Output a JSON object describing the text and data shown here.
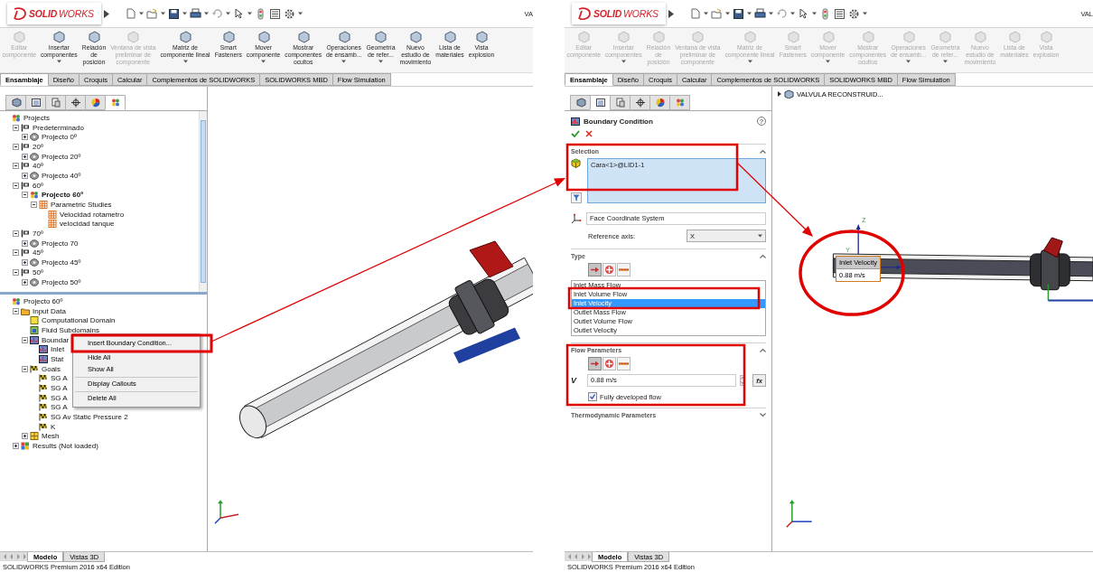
{
  "left_window": {
    "app_name": "**SOLID**WORKS",
    "title_fragment": "VA",
    "ribbon": [
      {
        "label": "Editar\ncomponente",
        "disabled": true,
        "dropdown": false
      },
      {
        "label": "Insertar\ncomponentes",
        "disabled": false,
        "dropdown": true
      },
      {
        "label": "Relación\nde\nposición",
        "disabled": false,
        "dropdown": false
      },
      {
        "label": "Ventana de vista\npreliminar de\ncomponente",
        "disabled": true,
        "dropdown": false
      },
      {
        "label": "Matriz de\ncomponente lineal",
        "disabled": false,
        "dropdown": true
      },
      {
        "label": "Smart\nFasteners",
        "disabled": false,
        "dropdown": false
      },
      {
        "label": "Mover\ncomponente",
        "disabled": false,
        "dropdown": true
      },
      {
        "label": "Mostrar\ncomponentes\nocultos",
        "disabled": false,
        "dropdown": false
      },
      {
        "label": "Operaciones\nde ensamb...",
        "disabled": false,
        "dropdown": true
      },
      {
        "label": "Geometría\nde refer...",
        "disabled": false,
        "dropdown": true
      },
      {
        "label": "Nuevo\nestudio de\nmovimiento",
        "disabled": false,
        "dropdown": false
      },
      {
        "label": "Lista de\nmateriales",
        "disabled": false,
        "dropdown": false
      },
      {
        "label": "Vista\nexplosion",
        "disabled": false,
        "dropdown": false
      }
    ],
    "command_tabs": [
      {
        "label": "Ensamblaje",
        "selected": true
      },
      {
        "label": "Diseño",
        "selected": false
      },
      {
        "label": "Croquis",
        "selected": false
      },
      {
        "label": "Calcular",
        "selected": false
      },
      {
        "label": "Complementos de SOLIDWORKS",
        "selected": false
      },
      {
        "label": "SOLIDWORKS MBD",
        "selected": false
      },
      {
        "label": "Flow Simulation",
        "selected": false
      }
    ],
    "panel_tabs": [
      {
        "kind": "feature_tree",
        "selected": false
      },
      {
        "kind": "property",
        "selected": false
      },
      {
        "kind": "configuration",
        "selected": false
      },
      {
        "kind": "dimxpert",
        "selected": false
      },
      {
        "kind": "display",
        "selected": false
      },
      {
        "kind": "flow",
        "selected": true
      }
    ],
    "project_tree": [
      {
        "label": "Projects",
        "kind": "projects",
        "children": [
          {
            "label": "Predeterminado",
            "kind": "config",
            "expanded": true,
            "children": [
              {
                "label": "Projecto 0º",
                "kind": "study",
                "expanded": false
              }
            ]
          },
          {
            "label": "20º",
            "kind": "config",
            "expanded": true,
            "children": [
              {
                "label": "Projecto 20º",
                "kind": "study",
                "expanded": false
              }
            ]
          },
          {
            "label": "40º",
            "kind": "config",
            "expanded": true,
            "children": [
              {
                "label": "Projecto 40º",
                "kind": "study",
                "expanded": false
              }
            ]
          },
          {
            "label": "60º",
            "kind": "config",
            "expanded": true,
            "children": [
              {
                "label": "Projecto 60º",
                "kind": "project",
                "expanded": true,
                "active": true,
                "children": [
                  {
                    "label": "Parametric Studies",
                    "kind": "table",
                    "expanded": true,
                    "children": [
                      {
                        "label": "Velocidad rotametro",
                        "kind": "table"
                      },
                      {
                        "label": "velocidad tanque",
                        "kind": "table"
                      }
                    ]
                  }
                ]
              }
            ]
          },
          {
            "label": "70º",
            "kind": "config",
            "expanded": true,
            "children": [
              {
                "label": "Projecto 70",
                "kind": "study",
                "expanded": false
              }
            ]
          },
          {
            "label": "45º",
            "kind": "config",
            "expanded": true,
            "children": [
              {
                "label": "Projecto 45º",
                "kind": "study",
                "expanded": false
              }
            ]
          },
          {
            "label": "50º",
            "kind": "config",
            "expanded": true,
            "children": [
              {
                "label": "Projecto 50º",
                "kind": "study",
                "expanded": false
              }
            ]
          }
        ]
      }
    ],
    "analysis_tree": [
      {
        "label": "Projecto 60º",
        "kind": "project",
        "children": [
          {
            "label": "Input Data",
            "kind": "folder",
            "expanded": true,
            "children": [
              {
                "label": "Computational Domain",
                "kind": "domain"
              },
              {
                "label": "Fluid Subdomains",
                "kind": "subdomain"
              },
              {
                "label": "Boundar",
                "kind": "boundary",
                "expanded": true,
                "children": [
                  {
                    "label": "Inlet",
                    "kind": "boundary"
                  },
                  {
                    "label": "Stat",
                    "kind": "boundary"
                  }
                ]
              },
              {
                "label": "Goals",
                "kind": "goals",
                "expanded": true,
                "children": [
                  {
                    "label": "SG A",
                    "kind": "goal"
                  },
                  {
                    "label": "SG A",
                    "kind": "goal"
                  },
                  {
                    "label": "SG A",
                    "kind": "goal"
                  },
                  {
                    "label": "SG A",
                    "kind": "goal"
                  },
                  {
                    "label": "SG Av Static Pressure 2",
                    "kind": "goal"
                  },
                  {
                    "label": "K",
                    "kind": "goal"
                  }
                ]
              },
              {
                "label": "Mesh",
                "kind": "mesh",
                "expanded": false
              }
            ]
          },
          {
            "label": "Results (Not loaded)",
            "kind": "results",
            "expanded": false
          }
        ]
      }
    ],
    "context_menu": [
      {
        "label": "Insert Boundary Condition...",
        "separator_before": false
      },
      {
        "label": "Hide All",
        "separator_before": true
      },
      {
        "label": "Show All",
        "separator_before": false
      },
      {
        "label": "Display Callouts",
        "separator_before": true
      },
      {
        "label": "Delete All",
        "separator_before": true
      }
    ],
    "viewport": {
      "kind": "diagonal_view"
    },
    "model_tabs": [
      {
        "label": "Modelo",
        "selected": true
      },
      {
        "label": "Vistas 3D",
        "selected": false
      }
    ],
    "status": "SOLIDWORKS Premium 2016 x64 Edition"
  },
  "right_window": {
    "app_name": "**SOLID**WORKS",
    "title_fragment": "VAL",
    "ribbon": [
      {
        "label": "Editar\ncomponente",
        "disabled": true,
        "dropdown": false
      },
      {
        "label": "Insertar\ncomponentes",
        "disabled": true,
        "dropdown": true
      },
      {
        "label": "Relación\nde\nposición",
        "disabled": true,
        "dropdown": false
      },
      {
        "label": "Ventana de vista\npreliminar de\ncomponente",
        "disabled": true,
        "dropdown": false
      },
      {
        "label": "Matriz de\ncomponente lineal",
        "disabled": true,
        "dropdown": true
      },
      {
        "label": "Smart\nFasteners",
        "disabled": true,
        "dropdown": false
      },
      {
        "label": "Mover\ncomponente",
        "disabled": true,
        "dropdown": true
      },
      {
        "label": "Mostrar\ncomponentes\nocultos",
        "disabled": true,
        "dropdown": false
      },
      {
        "label": "Operaciones\nde ensamb...",
        "disabled": true,
        "dropdown": true
      },
      {
        "label": "Geometría\nde refer...",
        "disabled": true,
        "dropdown": true
      },
      {
        "label": "Nuevo\nestudio de\nmovimiento",
        "disabled": true,
        "dropdown": false
      },
      {
        "label": "Lista de\nmateriales",
        "disabled": true,
        "dropdown": false
      },
      {
        "label": "Vista\nexplosion",
        "disabled": true,
        "dropdown": false
      }
    ],
    "command_tabs": [
      {
        "label": "Ensamblaje",
        "selected": true
      },
      {
        "label": "Diseño",
        "selected": false
      },
      {
        "label": "Croquis",
        "selected": false
      },
      {
        "label": "Calcular",
        "selected": false
      },
      {
        "label": "Complementos de SOLIDWORKS",
        "selected": false
      },
      {
        "label": "SOLIDWORKS MBD",
        "selected": false
      },
      {
        "label": "Flow Simulation",
        "selected": false
      }
    ],
    "panel_tabs": [
      {
        "kind": "feature_tree",
        "selected": false
      },
      {
        "kind": "property",
        "selected": true
      },
      {
        "kind": "configuration",
        "selected": false
      },
      {
        "kind": "dimxpert",
        "selected": false
      },
      {
        "kind": "display",
        "selected": false
      },
      {
        "kind": "flow",
        "selected": false
      }
    ],
    "property_manager": {
      "title": "Boundary Condition",
      "help": "?",
      "sections": [
        {
          "kind": "selection",
          "title": "Selection",
          "expanded": true,
          "items": [
            "Cara<1>@LID1-1"
          ],
          "coordinate_system": "Face Coordinate System",
          "reference_axis_label": "Reference axis:",
          "reference_axis": "X"
        },
        {
          "kind": "type",
          "title": "Type",
          "expanded": true,
          "options": [
            {
              "selected": true
            },
            {
              "selected": false
            },
            {
              "selected": false
            }
          ],
          "list": [
            {
              "label": "Inlet Mass Flow",
              "selected": false
            },
            {
              "label": "Inlet Volume Flow",
              "selected": false
            },
            {
              "label": "Inlet Velocity",
              "selected": true
            },
            {
              "label": "Outlet Mass Flow",
              "selected": false
            },
            {
              "label": "Outlet Volume Flow",
              "selected": false
            },
            {
              "label": "Outlet Velocity",
              "selected": false
            }
          ]
        },
        {
          "kind": "flow",
          "title": "Flow Parameters",
          "expanded": true,
          "options": [
            {
              "selected": true
            },
            {
              "selected": false
            },
            {
              "selected": false
            }
          ],
          "symbol": "V",
          "value": "0.88 m/s",
          "formula_button": "fx",
          "fully_developed": {
            "label": "Fully developed flow",
            "checked": true
          }
        },
        {
          "title": "Thermodynamic Parameters",
          "expanded": false
        }
      ]
    },
    "viewport": {
      "kind": "side_view",
      "tree_root": "VALVULA RECONSTRUID...",
      "axis_labels": [
        "Z",
        "Y"
      ],
      "callout": {
        "title": "Inlet Velocity",
        "value": "0.88 m/s"
      }
    },
    "model_tabs": [
      {
        "label": "Modelo",
        "selected": true
      },
      {
        "label": "Vistas 3D",
        "selected": false
      }
    ],
    "status": "SOLIDWORKS Premium 2016 x64 Edition"
  }
}
